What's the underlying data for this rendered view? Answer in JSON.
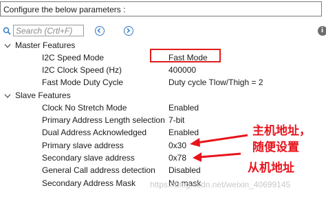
{
  "header": {
    "title": "Configure the below parameters :"
  },
  "toolbar": {
    "search_placeholder": "Search (Crtl+F)"
  },
  "groups": {
    "master": {
      "label": "Master Features",
      "rows": [
        {
          "name": "I2C Speed Mode",
          "value": "Fast Mode"
        },
        {
          "name": "I2C Clock Speed (Hz)",
          "value": "400000"
        },
        {
          "name": "Fast Mode Duty Cycle",
          "value": "Duty cycle Tlow/Thigh = 2"
        }
      ]
    },
    "slave": {
      "label": "Slave Features",
      "rows": [
        {
          "name": "Clock No Stretch Mode",
          "value": "Enabled"
        },
        {
          "name": "Primary Address Length selection",
          "value": "7-bit"
        },
        {
          "name": "Dual Address Acknowledged",
          "value": "Enabled"
        },
        {
          "name": "Primary slave address",
          "value": "0x30"
        },
        {
          "name": "Secondary slave address",
          "value": "0x78"
        },
        {
          "name": "General Call address detection",
          "value": "Disabled"
        },
        {
          "name": "Secondary Address Mask",
          "value": "No mask"
        }
      ]
    }
  },
  "annotations": {
    "primary_line1": "主机地址，",
    "primary_line2": "随便设置",
    "secondary": "从机地址",
    "color": "#e8131b"
  },
  "watermark": "https://blog.csdn.net/weixin_40699145",
  "icons": [
    "search-icon",
    "nav-prev-icon",
    "nav-next-icon",
    "info-icon",
    "caret-down-icon"
  ]
}
